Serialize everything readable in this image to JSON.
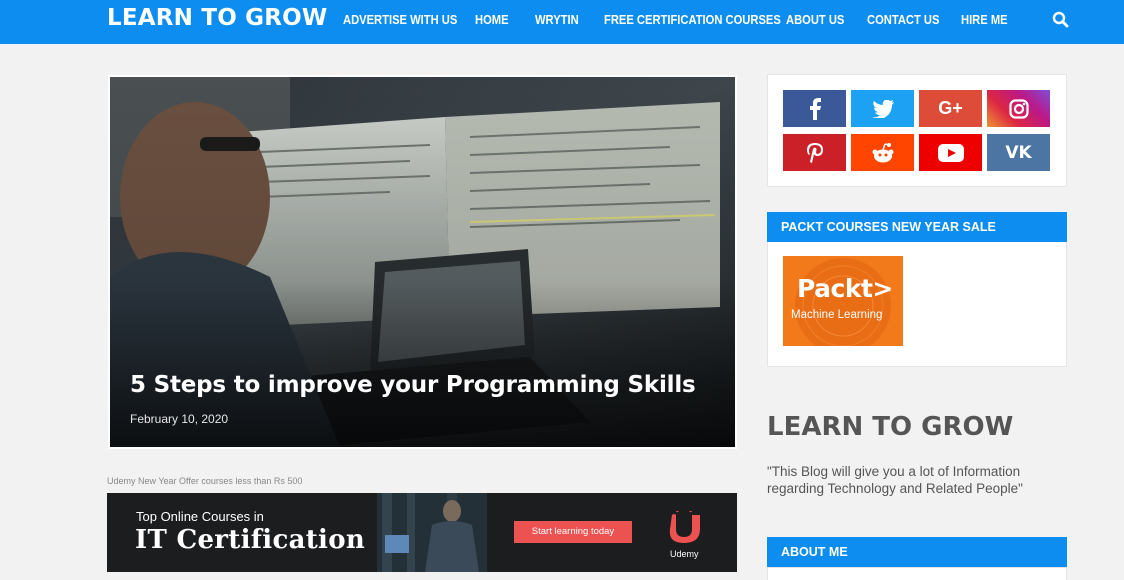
{
  "header": {
    "brand": "LEARN TO GROW",
    "menu": [
      "ADVERTISE WITH US",
      "HOME",
      "WRYTIN",
      "FREE CERTIFICATION COURSES",
      "ABOUT US",
      "CONTACT US",
      "HIRE ME"
    ],
    "search_icon": "search-icon"
  },
  "featured": {
    "title": "5 Steps to improve your Programming Skills",
    "date": "February 10, 2020"
  },
  "ad": {
    "caption": "Udemy New Year Offer courses less than Rs 500",
    "subtitle": "Top Online Courses in",
    "headline": "IT Certification",
    "cta": "Start learning today",
    "logo_text": "Udemy",
    "brand_color": "#ec5252"
  },
  "sidebar": {
    "social": [
      {
        "name": "facebook",
        "color": "#3b5998",
        "glyph": "f"
      },
      {
        "name": "twitter",
        "color": "#1da1f2",
        "glyph": ""
      },
      {
        "name": "google-plus",
        "color": "#dd4b39",
        "glyph": "G+"
      },
      {
        "name": "instagram",
        "color": "#c13584",
        "glyph": ""
      },
      {
        "name": "pinterest",
        "color": "#cb2027",
        "glyph": "P"
      },
      {
        "name": "reddit",
        "color": "#ff4500",
        "glyph": ""
      },
      {
        "name": "youtube",
        "color": "#e00",
        "glyph": ""
      },
      {
        "name": "vk",
        "color": "#4c75a3",
        "glyph": "VK"
      }
    ],
    "packt_heading": "PACKT COURSES NEW YEAR SALE",
    "packt_logo": "Packt>",
    "packt_sub": "Machine Learning",
    "about_title": "LEARN TO GROW",
    "about_desc": "\"This Blog will give you a lot of Information regarding Technology and Related People\"",
    "about_me_heading": "ABOUT ME"
  },
  "colors": {
    "accent": "#0e8df0",
    "background": "#f2f2f2"
  }
}
